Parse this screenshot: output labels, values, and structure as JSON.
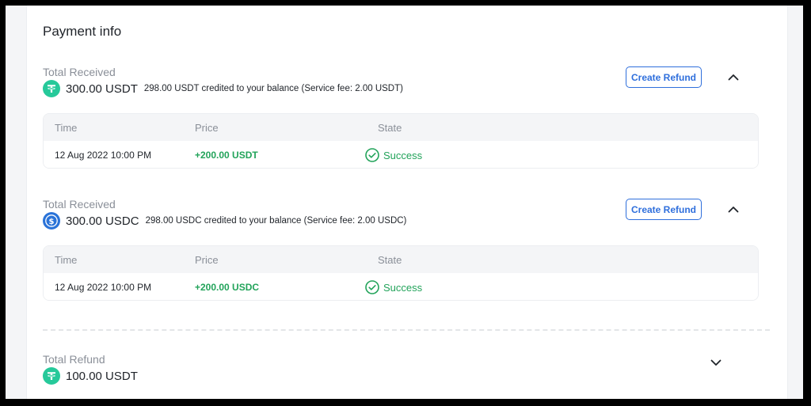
{
  "payment_info": {
    "title": "Payment info",
    "received": [
      {
        "label": "Total Received",
        "currency_icon": "tether-icon",
        "amount": "300.00 USDT",
        "note": "298.00 USDT credited to your balance (Service fee: 2.00 USDT)",
        "refund_label": "Create Refund",
        "table": {
          "headers": [
            "Time",
            "Price",
            "State"
          ],
          "rows": [
            {
              "time": "12 Aug 2022 10:00 PM",
              "price": "+200.00 USDT",
              "state": "Success"
            }
          ]
        }
      },
      {
        "label": "Total Received",
        "currency_icon": "usdc-icon",
        "amount": "300.00 USDC",
        "note": "298.00 USDC credited to your balance (Service fee: 2.00 USDC)",
        "refund_label": "Create Refund",
        "table": {
          "headers": [
            "Time",
            "Price",
            "State"
          ],
          "rows": [
            {
              "time": "12 Aug 2022 10:00 PM",
              "price": "+200.00 USDC",
              "state": "Success"
            }
          ]
        }
      }
    ],
    "refund": {
      "label": "Total Refund",
      "currency_icon": "tether-icon",
      "amount": "100.00 USDT"
    }
  },
  "colors": {
    "accent": "#2f6fdc",
    "success": "#22a35a",
    "usdt": "#26c99a",
    "usdc": "#2a73d8"
  }
}
